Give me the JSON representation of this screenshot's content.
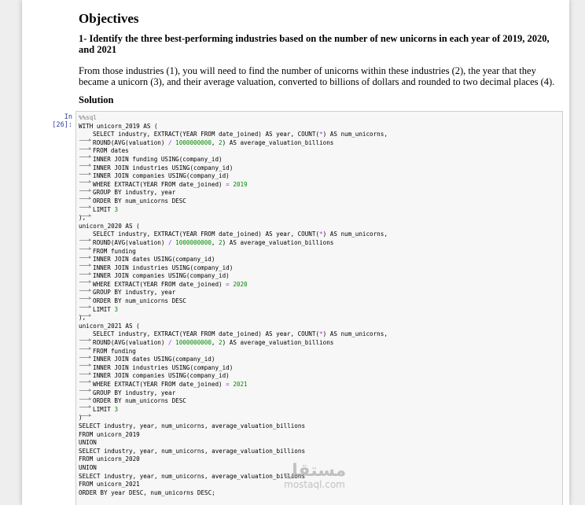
{
  "markdown": {
    "heading": "Objectives",
    "objective": "1- Identify the three best-performing industries based on the number of new unicorns in each year of 2019, 2020, and 2021",
    "description": "From those industries (1), you will need to find the number of unicorns within these industries (2), the year that they became a unicorn (3), and their average valuation, converted to billions of dollars and rounded to two decimal places (4).",
    "solution": "Solution"
  },
  "cell": {
    "prompt": "In [26]:",
    "lines": [
      {
        "indent": 0,
        "text": "%%sql"
      },
      {
        "indent": 0,
        "text": "WITH unicorn_2019 AS ("
      },
      {
        "indent": 1,
        "text": "SELECT industry, EXTRACT(YEAR FROM date_joined) AS year, COUNT(*) AS num_unicorns,"
      },
      {
        "indent": 1,
        "text": "ROUND(AVG(valuation) / 1000000000, 2) AS average_valuation_billions"
      },
      {
        "indent": 1,
        "text": "FROM dates"
      },
      {
        "indent": 1,
        "text": "INNER JOIN funding USING(company_id)"
      },
      {
        "indent": 1,
        "text": "INNER JOIN industries USING(company_id)"
      },
      {
        "indent": 1,
        "text": "INNER JOIN companies USING(company_id)"
      },
      {
        "indent": 1,
        "text": "WHERE EXTRACT(YEAR FROM date_joined) = 2019"
      },
      {
        "indent": 1,
        "text": "GROUP BY industry, year"
      },
      {
        "indent": 1,
        "text": "ORDER BY num_unicorns DESC"
      },
      {
        "indent": 1,
        "text": "LIMIT 3"
      },
      {
        "indent": 0,
        "text": "),"
      },
      {
        "indent": 0,
        "text": "unicorn_2020 AS ("
      },
      {
        "indent": 1,
        "text": "SELECT industry, EXTRACT(YEAR FROM date_joined) AS year, COUNT(*) AS num_unicorns,"
      },
      {
        "indent": 1,
        "text": "ROUND(AVG(valuation) / 1000000000, 2) AS average_valuation_billions"
      },
      {
        "indent": 1,
        "text": "FROM funding"
      },
      {
        "indent": 1,
        "text": "INNER JOIN dates USING(company_id)"
      },
      {
        "indent": 1,
        "text": "INNER JOIN industries USING(company_id)"
      },
      {
        "indent": 1,
        "text": "INNER JOIN companies USING(company_id)"
      },
      {
        "indent": 1,
        "text": "WHERE EXTRACT(YEAR FROM date_joined) = 2020"
      },
      {
        "indent": 1,
        "text": "GROUP BY industry, year"
      },
      {
        "indent": 1,
        "text": "ORDER BY num_unicorns DESC"
      },
      {
        "indent": 1,
        "text": "LIMIT 3"
      },
      {
        "indent": 0,
        "text": "),"
      },
      {
        "indent": 0,
        "text": "unicorn_2021 AS ("
      },
      {
        "indent": 1,
        "text": "SELECT industry, EXTRACT(YEAR FROM date_joined) AS year, COUNT(*) AS num_unicorns,"
      },
      {
        "indent": 1,
        "text": "ROUND(AVG(valuation) / 1000000000, 2) AS average_valuation_billions"
      },
      {
        "indent": 1,
        "text": "FROM funding"
      },
      {
        "indent": 1,
        "text": "INNER JOIN dates USING(company_id)"
      },
      {
        "indent": 1,
        "text": "INNER JOIN industries USING(company_id)"
      },
      {
        "indent": 1,
        "text": "INNER JOIN companies USING(company_id)"
      },
      {
        "indent": 1,
        "text": "WHERE EXTRACT(YEAR FROM date_joined) = 2021"
      },
      {
        "indent": 1,
        "text": "GROUP BY industry, year"
      },
      {
        "indent": 1,
        "text": "ORDER BY num_unicorns DESC"
      },
      {
        "indent": 1,
        "text": "LIMIT 3"
      },
      {
        "indent": 0,
        "text": ")"
      },
      {
        "indent": 0,
        "text": "SELECT industry, year, num_unicorns, average_valuation_billions"
      },
      {
        "indent": 0,
        "text": "FROM unicorn_2019"
      },
      {
        "indent": 0,
        "text": "UNION"
      },
      {
        "indent": 0,
        "text": "SELECT industry, year, num_unicorns, average_valuation_billions"
      },
      {
        "indent": 0,
        "text": "FROM unicorn_2020"
      },
      {
        "indent": 0,
        "text": "UNION"
      },
      {
        "indent": 0,
        "text": "SELECT industry, year, num_unicorns, average_valuation_billions"
      },
      {
        "indent": 0,
        "text": "FROM unicorn_2021"
      },
      {
        "indent": 0,
        "text": "ORDER BY year DESC, num_unicorns DESC;"
      }
    ]
  },
  "watermark": {
    "arabic": "مستقل",
    "latin": "mostaql.com"
  }
}
